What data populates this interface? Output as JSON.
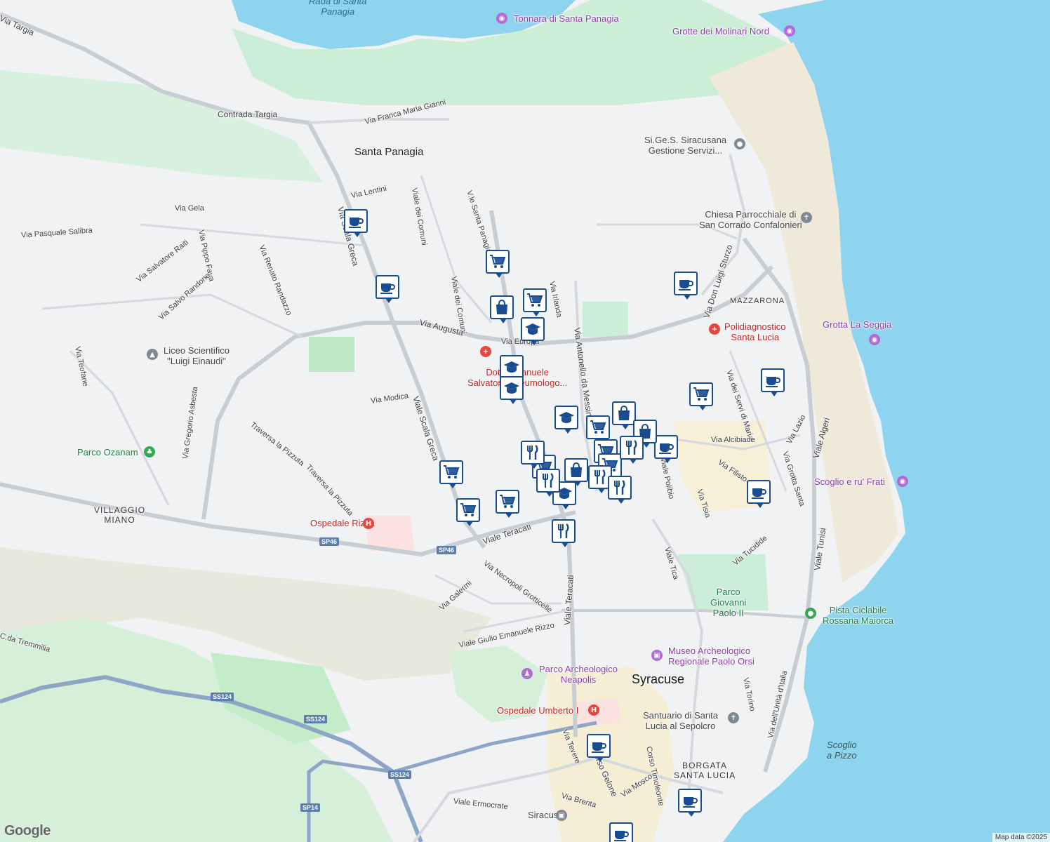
{
  "map": {
    "colors": {
      "sea": "#8fd4ee",
      "land": "#f1f2f4",
      "park": "#cdeed6",
      "road": "#c8cdd3",
      "highway": "#8ea6c6",
      "sand": "#efe9d9",
      "urban": "#f6eed4",
      "hospital_area": "#fbe1e0",
      "marker_border": "#1a4d8f"
    },
    "labels": {
      "rada": "Rada di Santa\nPanagia",
      "tonnara": "Tonnara di Santa Panagia",
      "grotte_molinari": "Grotte dei Molinari Nord",
      "contrada_targia": "Contrada Targia",
      "via_targia": "Via Targia",
      "via_franca": "Via Franca Maria Gianni",
      "santa_panagia": "Santa Panagia",
      "sigess": "Si.Ge.S. Siracusana\nGestione Servizi...",
      "via_lentini": "Via Lentini",
      "via_gela": "Via Gela",
      "viale_dei_comuni_1": "Viale dei Comuni",
      "vle_santa_panagia": "V.le Santa Panagia",
      "via_pasquale": "Via Pasquale Salibra",
      "via_pippo_fava": "Via Pippo Fava",
      "via_renato": "Via Renato Randazzo",
      "via_salvatore_raiti": "Via Salvatore Raiti",
      "via_salvo_randone": "Via Salvo Randone",
      "viale_scala_greca_n": "Via Scala Greca",
      "chiesa": "Chiesa Parrocchiale di\nSan Corrado Confalonieri",
      "via_don_luigi": "Via Don Luigi Sturzo",
      "mazzarona": "MAZZARONA",
      "via_irlanda": "Via Irlanda",
      "viale_dei_comuni_2": "Viale dei Comuni",
      "via_augusta": "Via Augusta",
      "via_europa": "Via Europa",
      "via_a_messina": "Via Antonello da Messina",
      "poli": "Polidiagnostico\nSanta Lucia",
      "grotta_seggia": "Grotta La Seggia",
      "liceo": "Liceo Scientifico\n\"Luigi Einaudi\"",
      "via_teofane": "Via Teofane",
      "dott": "Dott. Emanuele\nSalvatore Pneumologo...",
      "via_modica": "Via Modica",
      "via_gregorio": "Via Gregorio Asbesta",
      "viale_scala_greca_s": "Viale Scala Greca",
      "traversa_1": "Traversa la Pizzuta",
      "traversa_2": "Traversa la Pizzuta",
      "parco_ozanam": "Parco Ozanam",
      "via_servi": "Via dei Servi di Maria",
      "via_alcibiade": "Via Alcibiade",
      "via_filisto": "Via Filisto",
      "via_lazio": "Via Lazio",
      "via_grotta_santa": "Via Grotta Santa",
      "viale_algeri": "Viale Algeri",
      "scoglio_frati": "Scoglio e ru' Frati",
      "viale_polibio": "Viale Polibio",
      "via_tisia": "Via Tisia",
      "villaggio_miano": "VILLAGGIO\nMIANO",
      "ospedale_rizza": "Ospedale Rizza",
      "viale_teracati_w": "Viale Teracati",
      "viale_teracati_s": "Viale Teracati",
      "viale_tica": "Viale Tica",
      "via_tucidide": "Via Tucidide",
      "viale_tunisi": "Viale Tunisi",
      "via_necropoli": "Via Necropoli Grotticelle",
      "via_galermi": "Via Galermi",
      "parco_giovanni": "Parco\nGiovanni\nPaolo II",
      "pista_ciclabile": "Pista Ciclabile\nRossana Maiorca",
      "viale_giulio": "Viale Giulio Emanuele Rizzo",
      "tremmilia": "C.da Tremmilia",
      "museo": "Museo Archeologico\nRegionale Paolo Orsi",
      "parco_arch": "Parco Archeologico\nNeapolis",
      "syracuse": "Syracuse",
      "via_unita": "Via dell'Unità d'Italia",
      "via_torino": "Via Torino",
      "ospedale_umberto": "Ospedale Umberto I",
      "santuario": "Santuario di Santa\nLucia al Sepolcro",
      "scoglio_pizzo": "Scoglio\na Pizzo",
      "via_tevere": "Via Tevere",
      "corso_gelone": "Corso Gelone",
      "corso_timoleonte": "Corso Timoleonte",
      "via_mosco": "Via Mosco",
      "borgata": "BORGATA\nSANTA LUCIA",
      "via_brenta": "Via Brenta",
      "viale_ermocrate": "Viale Ermocrate",
      "siracusa": "Siracusa"
    },
    "shields": {
      "sp46_a": "SP46",
      "sp46_b": "SP46",
      "ss124_a": "SS124",
      "ss124_b": "SS124",
      "ss124_c": "SS124",
      "sp14": "SP14"
    },
    "markers": {
      "coffee_1": "coffee-icon",
      "coffee_2": "coffee-icon",
      "coffee_3": "coffee-icon",
      "coffee_4": "coffee-icon",
      "coffee_5": "coffee-icon",
      "coffee_6": "coffee-icon",
      "coffee_7": "coffee-icon",
      "coffee_8": "coffee-icon",
      "coffee_9": "coffee-icon",
      "cart": "shopping-cart-icon",
      "bag": "shopping-bag-icon",
      "school": "school-icon",
      "fork": "restaurant-icon"
    },
    "footer": {
      "logo": "Google",
      "attribution": "Map data ©2025"
    }
  }
}
